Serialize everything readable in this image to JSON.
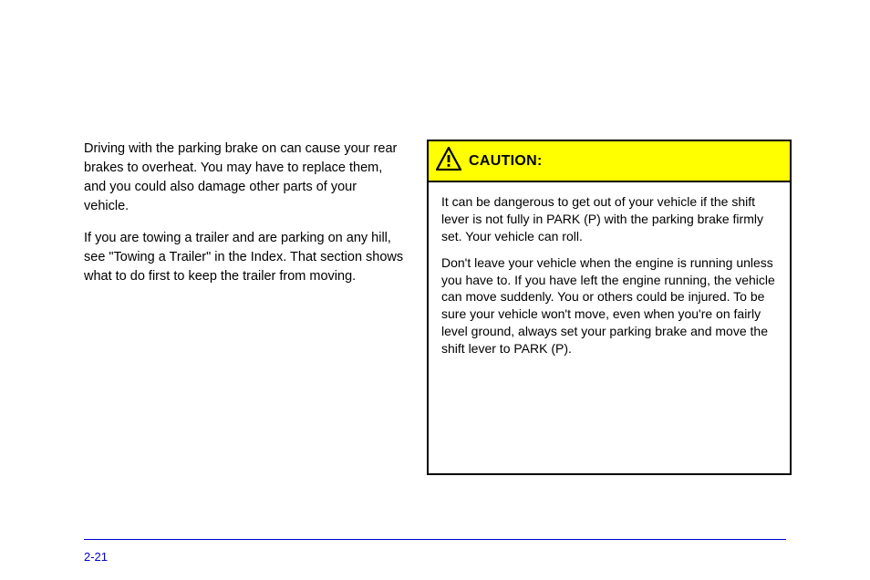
{
  "left_column": {
    "para1": "Driving with the parking brake on can cause your rear brakes to overheat. You may have to replace them, and you could also damage other parts of your vehicle.",
    "para2": "If you are towing a trailer and are parking on any hill, see \"Towing a Trailer\" in the Index. That section shows what to do first to keep the trailer from moving."
  },
  "caution": {
    "title": "CAUTION:",
    "body1": "It can be dangerous to get out of your vehicle if the shift lever is not fully in PARK (P) with the parking brake firmly set. Your vehicle can roll.",
    "body2": "Don't leave your vehicle when the engine is running unless you have to. If you have left the engine running, the vehicle can move suddenly. You or others could be injured. To be sure your vehicle won't move, even when you're on fairly level ground, always set your parking brake and move the shift lever to PARK (P)."
  },
  "footer": {
    "left": "2-21",
    "right": ""
  }
}
